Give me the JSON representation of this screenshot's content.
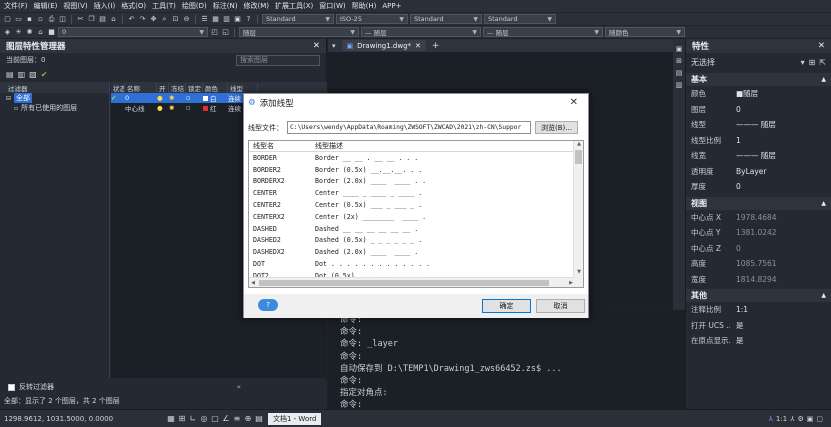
{
  "menubar": {
    "items": [
      "文件(F)",
      "编辑(E)",
      "视图(V)",
      "插入(I)",
      "格式(O)",
      "工具(T)",
      "绘图(D)",
      "标注(N)",
      "修改(M)",
      "扩展工具(X)",
      "窗口(W)",
      "帮助(H)",
      "APP+"
    ]
  },
  "toolbar": {
    "text_style": "Standard",
    "dim_style": "ISO-25",
    "table_style": "Standard",
    "mleader_style": "Standard",
    "layer_combo": "0",
    "color_combo": "随层",
    "linetype_combo": "— 随层",
    "lineweight_combo": "— 随层",
    "plotstyle_combo": "随颜色"
  },
  "layer_panel": {
    "title": "图层特性管理器",
    "current_layer_label": "当前图层：0",
    "search_placeholder": "搜索图层",
    "filter_header": "过滤器",
    "filters": [
      "全部",
      "所有已使用的图层"
    ],
    "columns": [
      "状态",
      "名称",
      "开",
      "冻结",
      "锁定",
      "颜色",
      "线型"
    ],
    "layers": [
      {
        "status": "✔",
        "name": "0",
        "color": "白",
        "linetype": "连续"
      },
      {
        "status": "",
        "name": "中心线",
        "color": "红",
        "linetype": "连续"
      }
    ],
    "invert_filter_label": "反转过滤器",
    "status_text": "全部：显示了 2 个图层，共 2 个图层"
  },
  "drawing": {
    "tab_label": "Drawing1.dwg*",
    "add_tab_label": "+"
  },
  "command_history": [
    "命令:",
    "命令:",
    "命令: _layer",
    "命令:",
    "自动保存到 D:\\TEMP1\\Drawing1_zws66452.zs$ ...",
    "命令:",
    "指定对角点:",
    "命令:"
  ],
  "properties": {
    "title": "特性",
    "selection": "无选择",
    "sections": [
      {
        "name": "基本",
        "rows": [
          {
            "label": "颜色",
            "value": "■随层",
            "dim": false
          },
          {
            "label": "图层",
            "value": "0",
            "dim": false
          },
          {
            "label": "线型",
            "value": "——— 随层",
            "dim": false
          },
          {
            "label": "线型比例",
            "value": "1",
            "dim": false
          },
          {
            "label": "线宽",
            "value": "——— 随层",
            "dim": false
          },
          {
            "label": "透明度",
            "value": "ByLayer",
            "dim": false
          },
          {
            "label": "厚度",
            "value": "0",
            "dim": false
          }
        ]
      },
      {
        "name": "视图",
        "rows": [
          {
            "label": "中心点 X",
            "value": "1978.4684",
            "dim": true
          },
          {
            "label": "中心点 Y",
            "value": "1381.0242",
            "dim": true
          },
          {
            "label": "中心点 Z",
            "value": "0",
            "dim": true
          },
          {
            "label": "高度",
            "value": "1085.7561",
            "dim": true
          },
          {
            "label": "宽度",
            "value": "1814.8294",
            "dim": true
          }
        ]
      },
      {
        "name": "其他",
        "rows": [
          {
            "label": "注释比例",
            "value": "1:1",
            "dim": false
          },
          {
            "label": "打开 UCS ...",
            "value": "是",
            "dim": false
          },
          {
            "label": "在原点显示...",
            "value": "是",
            "dim": false
          }
        ]
      }
    ]
  },
  "dialog": {
    "title": "添加线型",
    "file_label": "线型文件：",
    "file_path": "C:\\Users\\wendy\\AppData\\Roaming\\ZWSOFT\\ZWCAD\\2021\\zh-CN\\Suppor",
    "browse_label": "浏览(B)...",
    "col_name": "线型名",
    "col_desc": "线型描述",
    "linetypes": [
      {
        "name": "BORDER",
        "desc": "Border __ __ . __ __ . . ."
      },
      {
        "name": "BORDER2",
        "desc": "Border (0.5x) __.__.__. . ."
      },
      {
        "name": "BORDERX2",
        "desc": "Border (2.0x) ____  ____ . ."
      },
      {
        "name": "CENTER",
        "desc": "Center ____ _ ____ _ ____ ."
      },
      {
        "name": "CENTER2",
        "desc": "Center (0.5x) ___ _ ___ _ ."
      },
      {
        "name": "CENTERX2",
        "desc": "Center (2x) ________  ____ ."
      },
      {
        "name": "DASHED",
        "desc": "Dashed __ __ __ __ __ __ ."
      },
      {
        "name": "DASHED2",
        "desc": "Dashed (0.5x) _ _ _ _ _ _ ."
      },
      {
        "name": "DASHEDX2",
        "desc": "Dashed (2.0x) ____  ____ ."
      },
      {
        "name": "DOT",
        "desc": "Dot . . . . . . . . . . . . ."
      },
      {
        "name": "DOT2",
        "desc": "Dot (0.5x) ..............."
      },
      {
        "name": "DOTX2",
        "desc": "Dot (2.0x) .  .  .  .  .  ."
      }
    ],
    "help_label": "?",
    "ok_label": "确定",
    "cancel_label": "取消"
  },
  "statusbar": {
    "coords": "1298.9612, 1031.5000, 0.0000",
    "taskbar_item": "文档1 - Word",
    "scale": "1:1"
  }
}
